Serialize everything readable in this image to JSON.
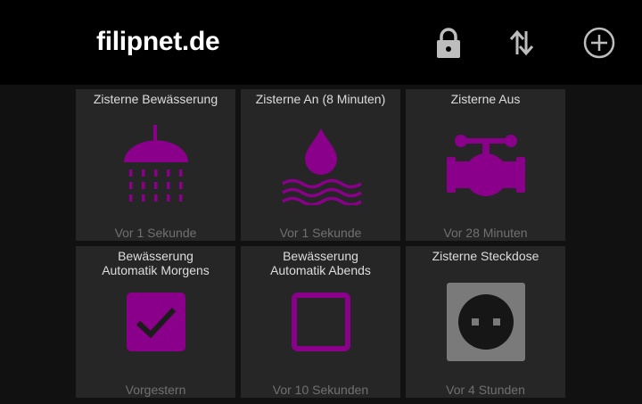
{
  "header": {
    "title": "filipnet.de",
    "icons": [
      "lock-icon",
      "sort-arrows-icon",
      "add-circle-icon"
    ]
  },
  "colors": {
    "accent": "#8b008b",
    "tile_bg": "#262626",
    "header_bg": "#000000",
    "page_bg": "#111111",
    "socket_plate": "#7a7a7a"
  },
  "tiles": [
    {
      "title": "Zisterne Bewässerung",
      "status": "Vor 1 Sekunde",
      "icon": "shower-icon"
    },
    {
      "title": "Zisterne An (8 Minuten)",
      "status": "Vor 1 Sekunde",
      "icon": "water-drop-waves-icon"
    },
    {
      "title": "Zisterne Aus",
      "status": "Vor 28 Minuten",
      "icon": "valve-pipe-icon"
    },
    {
      "title_line1": "Bewässerung",
      "title_line2": "Automatik Morgens",
      "status": "Vorgestern",
      "icon": "checkbox-checked-icon",
      "checked": true
    },
    {
      "title_line1": "Bewässerung",
      "title_line2": "Automatik Abends",
      "status": "Vor 10 Sekunden",
      "icon": "checkbox-unchecked-icon",
      "checked": false
    },
    {
      "title": "Zisterne Steckdose",
      "status": "Vor 4 Stunden",
      "icon": "power-socket-icon"
    }
  ]
}
